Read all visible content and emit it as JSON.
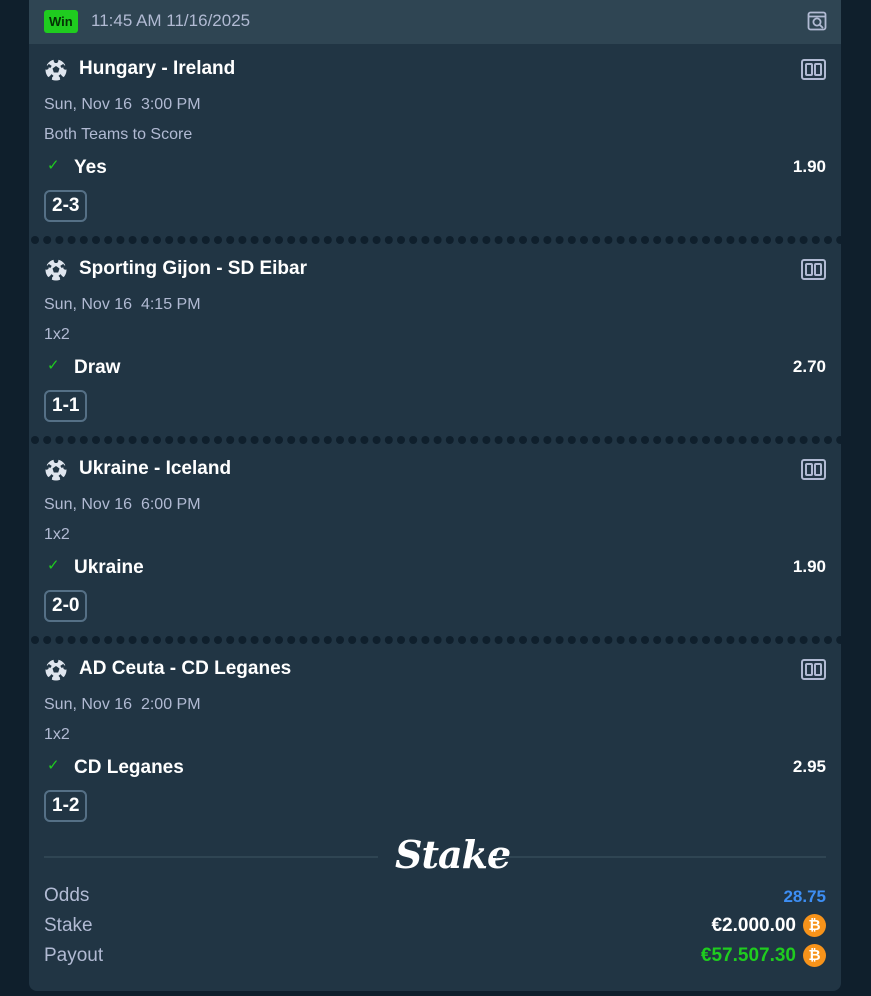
{
  "header": {
    "status_badge": "Win",
    "timestamp": "11:45 AM 11/16/2025",
    "icon": "search-icon"
  },
  "legs": [
    {
      "match": "Hungary - Ireland",
      "datetime": "Sun, Nov 16  3:00 PM",
      "market": "Both Teams to Score",
      "selection": "Yes",
      "odds": "1.90",
      "result": "2-3"
    },
    {
      "match": "Sporting Gijon - SD Eibar",
      "datetime": "Sun, Nov 16  4:15 PM",
      "market": "1x2",
      "selection": "Draw",
      "odds": "2.70",
      "result": "1-1"
    },
    {
      "match": "Ukraine - Iceland",
      "datetime": "Sun, Nov 16  6:00 PM",
      "market": "1x2",
      "selection": "Ukraine",
      "odds": "1.90",
      "result": "2-0"
    },
    {
      "match": "AD Ceuta - CD Leganes",
      "datetime": "Sun, Nov 16  2:00 PM",
      "market": "1x2",
      "selection": "CD Leganes",
      "odds": "2.95",
      "result": "1-2"
    }
  ],
  "brand": "Stake",
  "summary": {
    "odds_label": "Odds",
    "odds_value": "28.75",
    "stake_label": "Stake",
    "stake_value": "€2.000.00",
    "payout_label": "Payout",
    "payout_value": "€57.507.30",
    "currency_icon": "bitcoin-icon"
  },
  "colors": {
    "win": "#1fcc1f",
    "odds_total": "#3d8ef4",
    "bitcoin": "#f7931a",
    "panel": "#213544",
    "header": "#2f4553"
  }
}
